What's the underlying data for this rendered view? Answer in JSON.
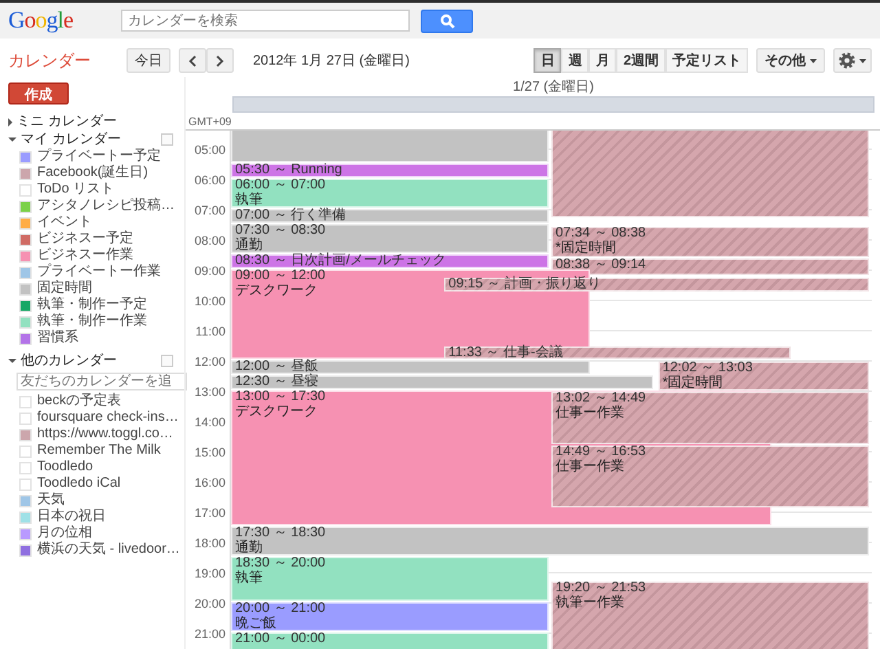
{
  "header": {
    "logo": "Google",
    "search": {
      "placeholder": "カレンダーを検索"
    }
  },
  "app_title": "カレンダー",
  "toolbar": {
    "today": "今日",
    "date": "2012年 1月 27日 (金曜日)",
    "views": [
      {
        "label": "日",
        "selected": true
      },
      {
        "label": "週",
        "selected": false
      },
      {
        "label": "月",
        "selected": false
      },
      {
        "label": "2週間",
        "selected": false
      },
      {
        "label": "予定リスト",
        "selected": false
      }
    ],
    "more": "その他"
  },
  "sidebar": {
    "create": "作成",
    "mini_calendar": {
      "label": "ミニ カレンダー",
      "expanded": false
    },
    "my_calendars": {
      "label": "マイ カレンダー",
      "expanded": true,
      "items": [
        {
          "name": "プライベートー予定",
          "color": "#9a9cff"
        },
        {
          "name": "Facebook(誕生日)",
          "color": "#cca6ac"
        },
        {
          "name": "ToDo リスト",
          "color": "#ffffff"
        },
        {
          "name": "アシタノレシピ投稿…",
          "color": "#7bd148"
        },
        {
          "name": "イベント",
          "color": "#ffad46"
        },
        {
          "name": "ビジネスー予定",
          "color": "#d06b64"
        },
        {
          "name": "ビジネスー作業",
          "color": "#f691b2"
        },
        {
          "name": "プライベートー作業",
          "color": "#9fc6e7"
        },
        {
          "name": "固定時間",
          "color": "#c2c2c2"
        },
        {
          "name": "執筆・制作ー予定",
          "color": "#16a765"
        },
        {
          "name": "執筆・制作ー作業",
          "color": "#92e1c0"
        },
        {
          "name": "習慣系",
          "color": "#b373e8"
        }
      ]
    },
    "other_calendars": {
      "label": "他のカレンダー",
      "expanded": true,
      "placeholder": "友だちのカレンダーを追",
      "items": [
        {
          "name": "beckの予定表",
          "color": "#ffffff"
        },
        {
          "name": "foursquare check-ins…",
          "color": "#ffffff"
        },
        {
          "name": "https://www.toggl.co…",
          "color": "#cca6ac"
        },
        {
          "name": "Remember The Milk",
          "color": "#ffffff"
        },
        {
          "name": "Toodledo",
          "color": "#ffffff"
        },
        {
          "name": "Toodledo iCal",
          "color": "#ffffff"
        },
        {
          "name": "天気",
          "color": "#9fc6e7"
        },
        {
          "name": "日本の祝日",
          "color": "#9fe1e7"
        },
        {
          "name": "月の位相",
          "color": "#b99aff"
        },
        {
          "name": "横浜の天気 - livedoor…",
          "color": "#8f6fe0"
        }
      ]
    }
  },
  "day_view": {
    "day_header": "1/27 (金曜日)",
    "timezone": "GMT+09",
    "hours": [
      "05:00",
      "06:00",
      "07:00",
      "08:00",
      "09:00",
      "10:00",
      "11:00",
      "12:00",
      "13:00",
      "14:00",
      "15:00",
      "16:00",
      "17:00",
      "18:00",
      "19:00",
      "20:00",
      "21:00"
    ],
    "events": [
      {
        "kind": "solid",
        "color": "#c2c2c2"
      },
      {
        "kind": "striped",
        "color": "#d5a6ad"
      },
      {
        "kind": "solid",
        "color": "#cd74e6",
        "time": "05:30 ～ Running"
      },
      {
        "kind": "solid",
        "color": "#92e1c0",
        "time": "06:00 ～ 07:00",
        "title": "執筆"
      },
      {
        "kind": "solid",
        "color": "#c2c2c2",
        "time": "07:00 ～ 行く準備"
      },
      {
        "kind": "solid",
        "color": "#c2c2c2",
        "time": "07:30 ～ 08:30",
        "title": "通勤"
      },
      {
        "kind": "striped",
        "color": "#d5a6ad",
        "time": "07:34 ～ 08:38",
        "title": "*固定時間"
      },
      {
        "kind": "solid",
        "color": "#cd74e6",
        "time": "08:30 ～ 日次計画/メールチェック"
      },
      {
        "kind": "striped",
        "color": "#d5a6ad",
        "time": "08:38 ～ 09:14"
      },
      {
        "kind": "solid",
        "color": "#f691b2",
        "time": "09:00 ～ 12:00",
        "title": "デスクワーク"
      },
      {
        "kind": "striped",
        "color": "#d5a6ad",
        "time": "09:15 ～ 計画・振り返り"
      },
      {
        "kind": "striped",
        "color": "#d5a6ad",
        "time": "11:33 ～ 仕事-会議"
      },
      {
        "kind": "solid",
        "color": "#c2c2c2",
        "time": "12:00 ～ 昼飯"
      },
      {
        "kind": "solid",
        "color": "#c2c2c2",
        "time": "12:30 ～ 昼寝"
      },
      {
        "kind": "striped",
        "color": "#d5a6ad",
        "time": "12:02 ～ 13:03",
        "title": "*固定時間"
      },
      {
        "kind": "solid",
        "color": "#f691b2",
        "time": "13:00 ～ 17:30",
        "title": "デスクワーク"
      },
      {
        "kind": "striped",
        "color": "#d5a6ad",
        "time": "13:02 ～ 14:49",
        "title": "仕事ー作業"
      },
      {
        "kind": "striped",
        "color": "#d5a6ad",
        "time": "14:49 ～ 16:53",
        "title": "仕事ー作業"
      },
      {
        "kind": "solid",
        "color": "#c2c2c2",
        "time": "17:30 ～ 18:30",
        "title": "通勤"
      },
      {
        "kind": "solid",
        "color": "#92e1c0",
        "time": "18:30 ～ 20:00",
        "title": "執筆"
      },
      {
        "kind": "striped",
        "color": "#d5a6ad",
        "time": "19:20 ～ 21:53",
        "title": "執筆ー作業"
      },
      {
        "kind": "solid",
        "color": "#9a9cff",
        "time": "20:00 ～ 21:00",
        "title": "晩ご飯"
      },
      {
        "kind": "solid",
        "color": "#92e1c0",
        "time": "21:00 ～ 00:00"
      }
    ]
  }
}
